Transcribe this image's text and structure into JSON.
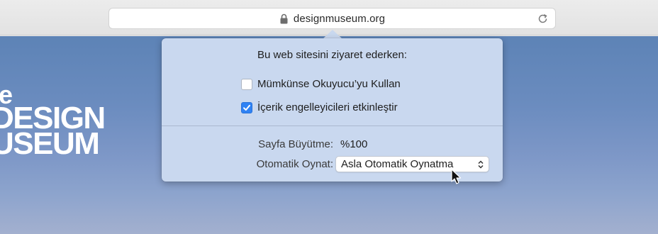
{
  "browser": {
    "url": "designmuseum.org"
  },
  "webpage": {
    "logo_lines": [
      "e",
      "DESIGN",
      "USEUM"
    ]
  },
  "popover": {
    "title": "Bu web sitesini ziyaret ederken:",
    "options": [
      {
        "label": "Mümkünse Okuyucu’yu Kullan",
        "checked": false
      },
      {
        "label": "İçerik engelleyicileri etkinleştir",
        "checked": true
      }
    ],
    "page_zoom": {
      "label": "Sayfa Büyütme:",
      "value": "%100"
    },
    "autoplay": {
      "label": "Otomatik Oynat:",
      "selected": "Asla Otomatik Oynatma"
    }
  },
  "colors": {
    "accent": "#2f82f4",
    "popover_bg": "#c9d8ef",
    "page_sky": "#6b8cbf"
  },
  "icons": [
    "lock-icon",
    "reload-icon",
    "checkmark-icon",
    "select-arrows-icon",
    "mouse-pointer-icon"
  ]
}
